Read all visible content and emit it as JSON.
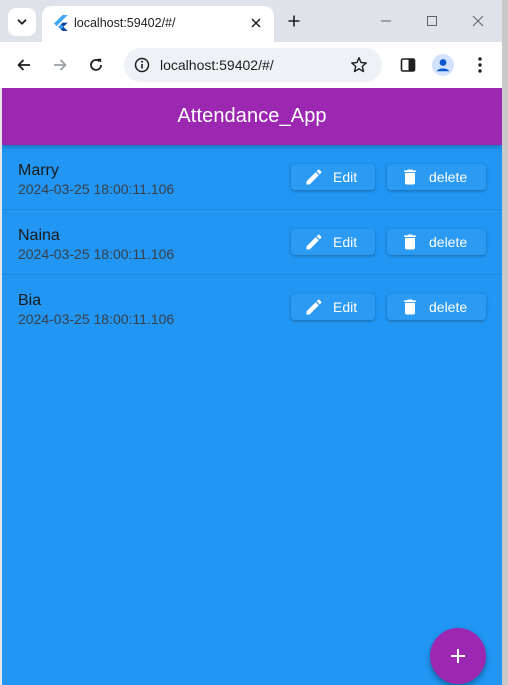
{
  "browser": {
    "tab_title": "localhost:59402/#/",
    "url": "localhost:59402/#/"
  },
  "app": {
    "title": "Attendance_App",
    "accent_color": "#9c27b0",
    "background_color": "#2196f3",
    "entries": [
      {
        "name": "Marry",
        "timestamp": "2024-03-25 18:00:11.106",
        "edit_label": "Edit",
        "delete_label": "delete"
      },
      {
        "name": "Naina",
        "timestamp": "2024-03-25 18:00:11.106",
        "edit_label": "Edit",
        "delete_label": "delete"
      },
      {
        "name": "Bia",
        "timestamp": "2024-03-25 18:00:11.106",
        "edit_label": "Edit",
        "delete_label": "delete"
      }
    ],
    "fab_icon": "plus-icon"
  }
}
